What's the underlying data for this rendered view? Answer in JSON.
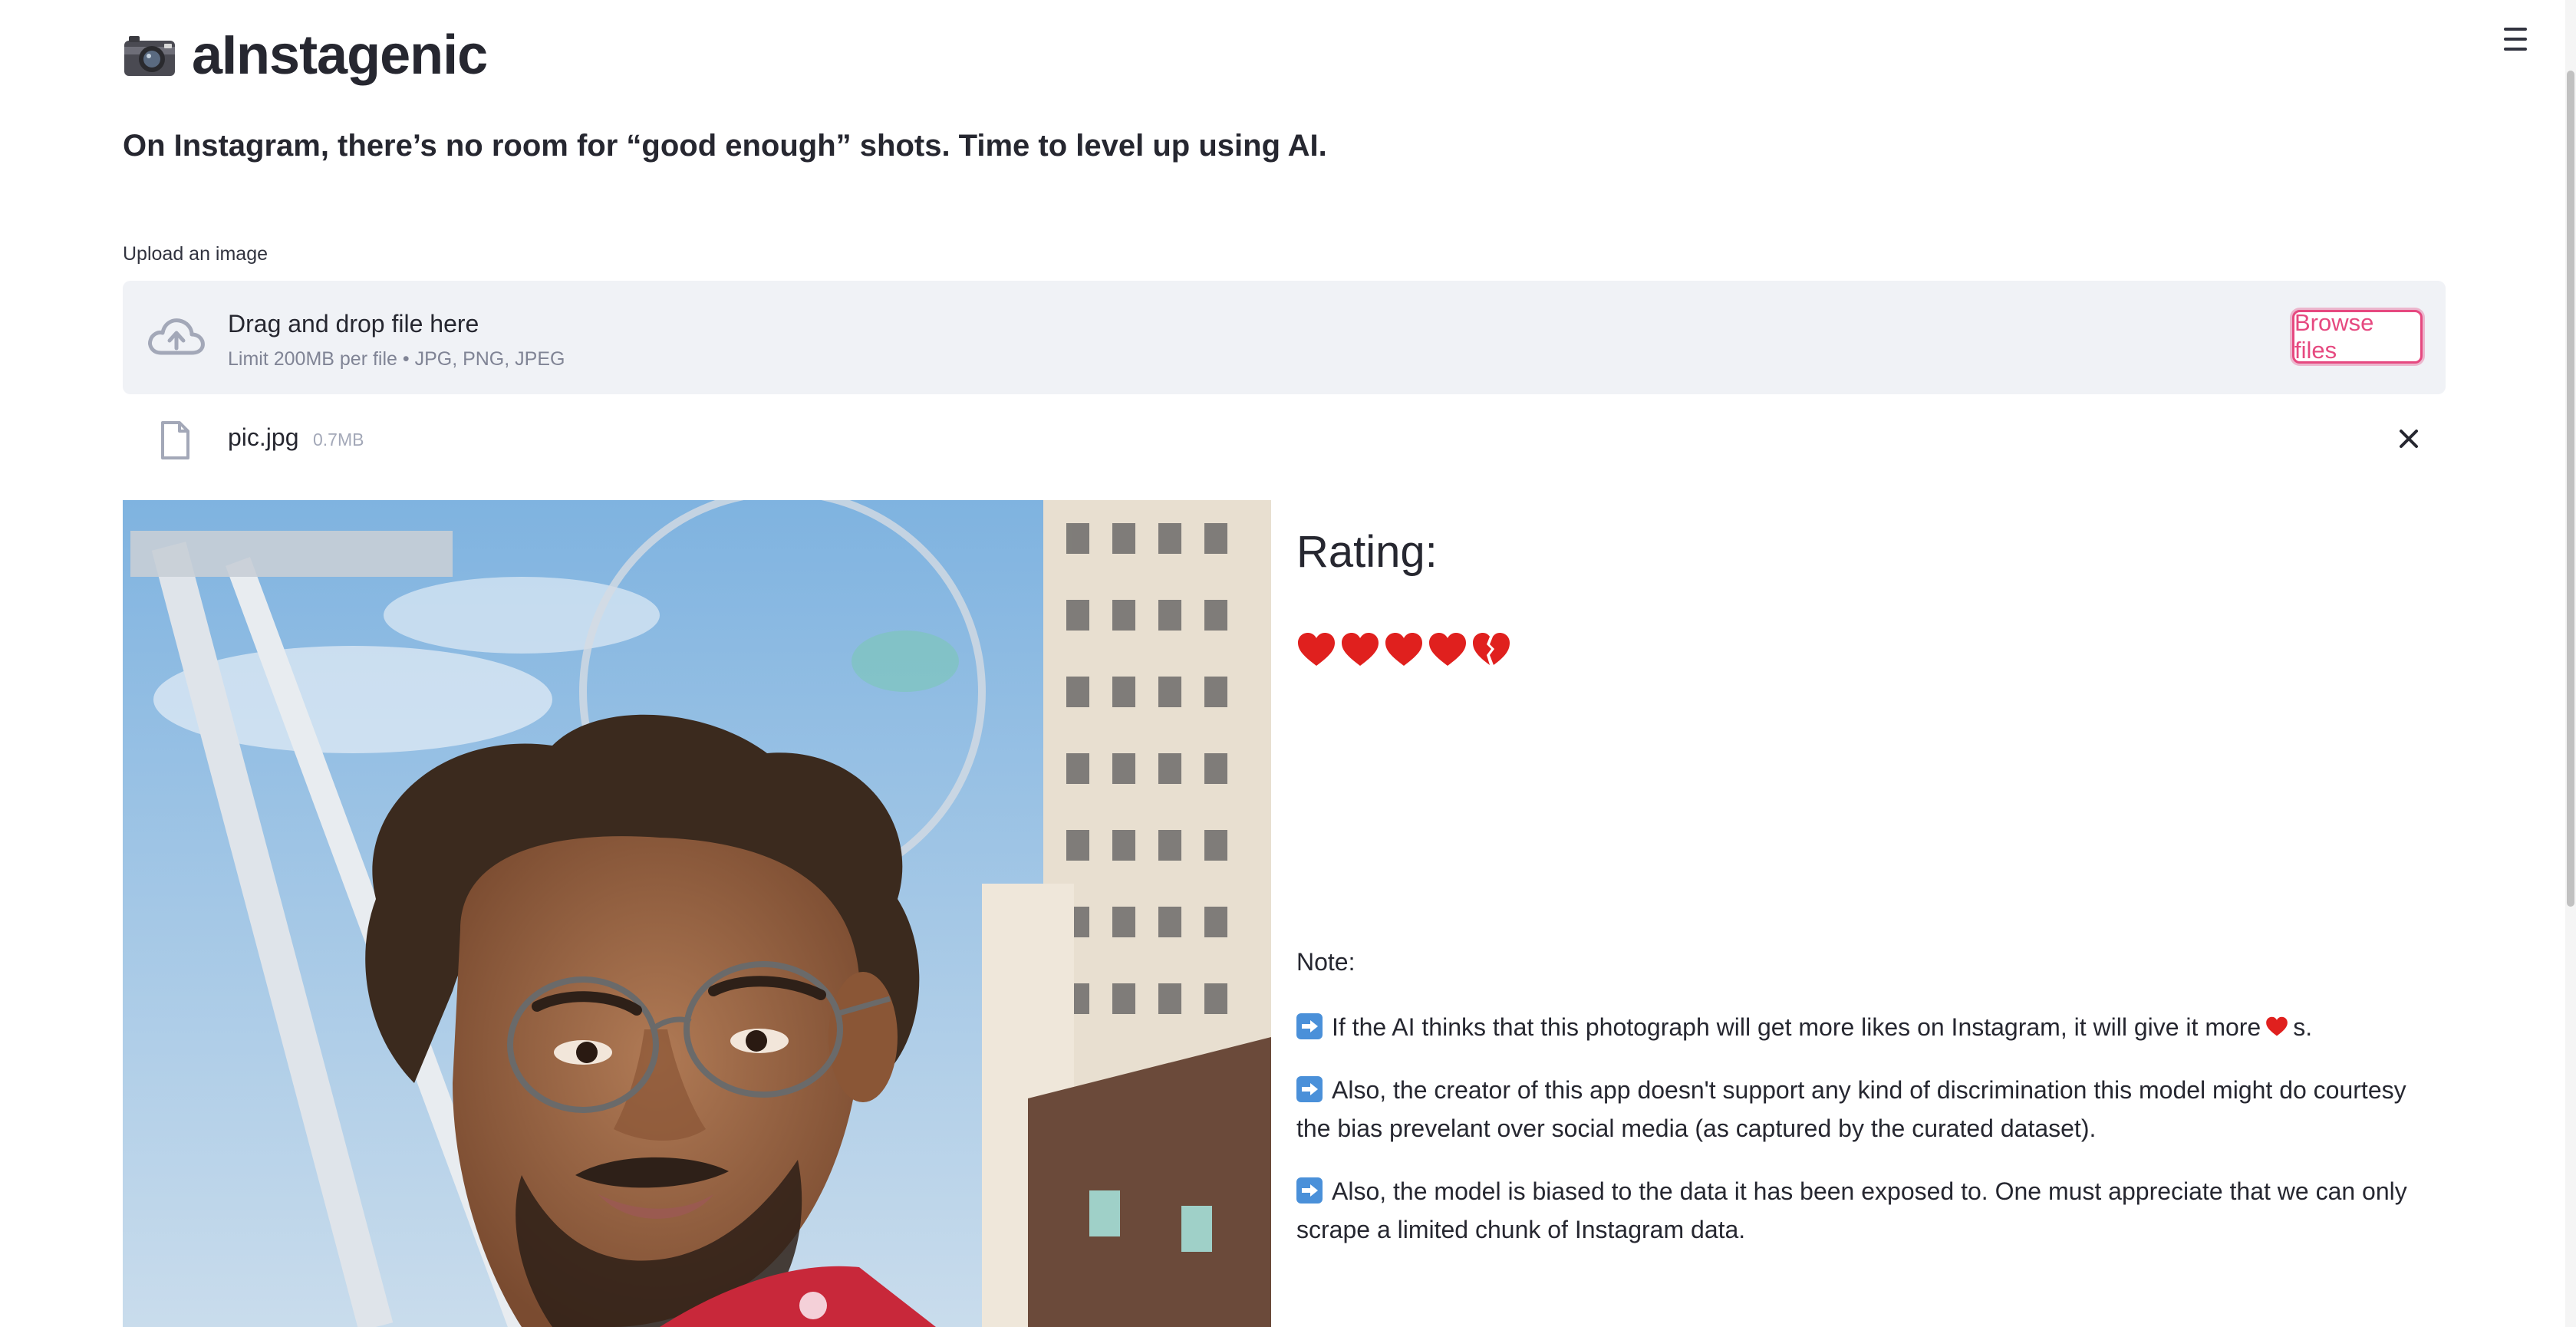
{
  "app": {
    "title": "aInstagenic",
    "subtitle": "On Instagram, there’s no room for “good enough” shots. Time to level up using AI."
  },
  "uploader": {
    "label": "Upload an image",
    "drop_title": "Drag and drop file here",
    "limit_text": "Limit 200MB per file • JPG, PNG, JPEG",
    "browse_label": "Browse files"
  },
  "file": {
    "name": "pic.jpg",
    "size": "0.7MB"
  },
  "result": {
    "heading": "Rating:",
    "rating_full_hearts": 4,
    "rating_broken_hearts": 1
  },
  "notes": {
    "label": "Note:",
    "line1_a": "If the AI thinks that this photograph will get more likes on Instagram, it will give it more",
    "line1_b": "s.",
    "line2": "Also, the creator of this app doesn't support any kind of discrimination this model might do courtesy the bias prevelant over social media (as captured by the curated dataset).",
    "line3": "Also, the model is biased to the data it has been exposed to. One must appreciate that we can only scrape a limited chunk of Instagram data."
  },
  "colors": {
    "accent": "#e64980",
    "heart": "#e0201e",
    "dropzone_bg": "#f0f2f6",
    "arrow_icon": "#4a90d9"
  },
  "icons": [
    "camera-icon",
    "menu-icon",
    "cloud-upload-icon",
    "file-icon",
    "close-icon",
    "heart-icon",
    "broken-heart-icon",
    "arrow-right-icon"
  ]
}
